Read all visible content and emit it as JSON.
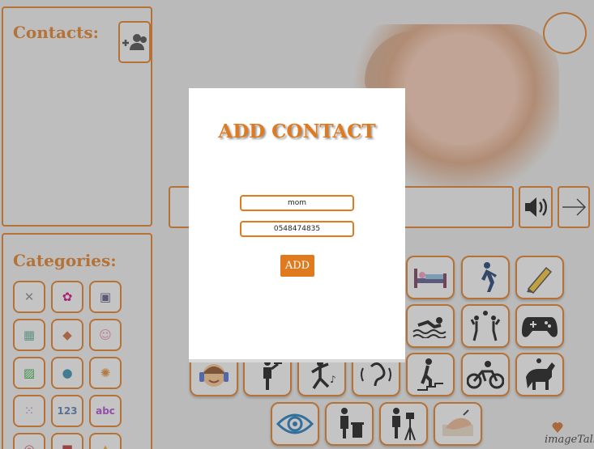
{
  "contacts": {
    "title": "Contacts:"
  },
  "categories": {
    "title": "Categories:",
    "tiles": [
      "",
      "",
      "",
      "",
      "",
      "",
      "",
      "",
      "",
      "",
      "123",
      "abc",
      "",
      "",
      ""
    ]
  },
  "modal": {
    "title": "ADD CONTACT",
    "name_value": "mom",
    "phone_value": "0548474835",
    "add_label": "ADD"
  },
  "brand": {
    "text": "imageTalk"
  },
  "colors": {
    "accent": "#e07a1f"
  },
  "cards": [
    {
      "name": "sleep-icon"
    },
    {
      "name": "walk-icon"
    },
    {
      "name": "crayon-icon"
    },
    {
      "name": "swim-icon"
    },
    {
      "name": "play-ball-icon"
    },
    {
      "name": "gamepad-icon"
    },
    {
      "name": "music-boy-icon"
    },
    {
      "name": "hammer-icon"
    },
    {
      "name": "dance-icon"
    },
    {
      "name": "ear-icon"
    },
    {
      "name": "climb-stairs-icon"
    },
    {
      "name": "bike-icon"
    },
    {
      "name": "horse-ride-icon"
    },
    {
      "name": "eye-icon"
    },
    {
      "name": "trash-icon"
    },
    {
      "name": "photographer-icon"
    },
    {
      "name": "write-hand-icon"
    }
  ]
}
